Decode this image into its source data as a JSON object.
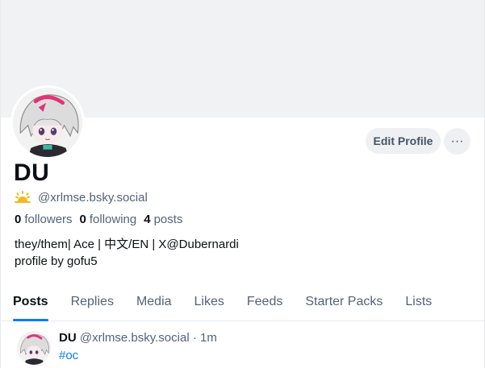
{
  "profile": {
    "display_name": "DU",
    "handle": "@xrlmse.bsky.social",
    "followers_count": "0",
    "followers_label": "followers",
    "following_count": "0",
    "following_label": "following",
    "posts_count": "4",
    "posts_label": "posts",
    "bio_line1": "they/them| Ace | 中文/EN | X@Dubernardi",
    "bio_line2": "profile by gofu5",
    "badge_icon": "sun-icon"
  },
  "actions": {
    "edit_profile_label": "Edit Profile",
    "more_label": "···"
  },
  "tabs": [
    {
      "label": "Posts",
      "active": true
    },
    {
      "label": "Replies"
    },
    {
      "label": "Media"
    },
    {
      "label": "Likes"
    },
    {
      "label": "Feeds"
    },
    {
      "label": "Starter Packs"
    },
    {
      "label": "Lists"
    }
  ],
  "post": {
    "author": "DU",
    "handle": "@xrlmse.bsky.social",
    "separator": "·",
    "time": "1m",
    "text": "#oc"
  },
  "colors": {
    "accent": "#0a7aff",
    "banner": "#f1f2f4",
    "muted_text": "#52637a"
  }
}
